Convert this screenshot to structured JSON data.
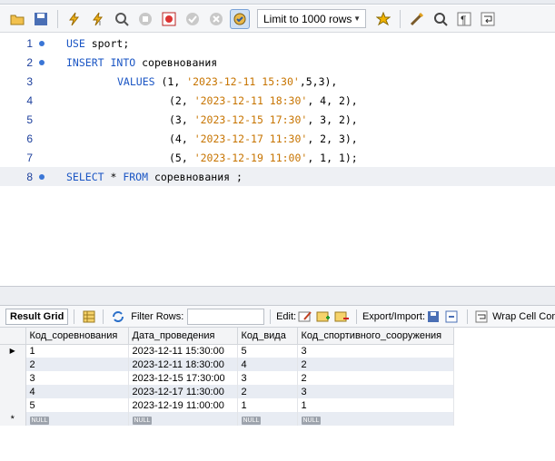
{
  "toolbar": {
    "limit_select": "Limit to 1000 rows"
  },
  "editor": {
    "lines": [
      {
        "n": "1",
        "dot": true
      },
      {
        "n": "2",
        "dot": true
      },
      {
        "n": "3",
        "dot": false
      },
      {
        "n": "4",
        "dot": false
      },
      {
        "n": "5",
        "dot": false
      },
      {
        "n": "6",
        "dot": false
      },
      {
        "n": "7",
        "dot": false
      },
      {
        "n": "8",
        "dot": true
      }
    ],
    "tokens": {
      "use": "USE",
      "use_rest": " sport;",
      "insert": "INSERT",
      "into": "INTO",
      "table": " соревнования",
      "values": "VALUES",
      "r1": [
        "(1, ",
        "'2023-12-11 15:30'",
        ",5,3),"
      ],
      "r2": [
        "(2, ",
        "'2023-12-11 18:30'",
        ", 4, 2),"
      ],
      "r3": [
        "(3, ",
        "'2023-12-15 17:30'",
        ", 3, 2),"
      ],
      "r4": [
        "(4, ",
        "'2023-12-17 11:30'",
        ", 2, 3),"
      ],
      "r5": [
        "(5, ",
        "'2023-12-19 11:00'",
        ", 1, 1);"
      ],
      "select": "SELECT",
      "star": " * ",
      "from": "FROM",
      "select_rest": " соревнования ;"
    }
  },
  "results_toolbar": {
    "result_grid": "Result Grid",
    "filter_rows": "Filter Rows:",
    "edit": "Edit:",
    "export_import": "Export/Import:",
    "wrap_cell": "Wrap Cell Cor"
  },
  "grid": {
    "columns": [
      "Код_соревнования",
      "Дата_проведения",
      "Код_вида",
      "Код_спортивного_сооружения"
    ],
    "rows": [
      [
        "1",
        "2023-12-11 15:30:00",
        "5",
        "3"
      ],
      [
        "2",
        "2023-12-11 18:30:00",
        "4",
        "2"
      ],
      [
        "3",
        "2023-12-15 17:30:00",
        "3",
        "2"
      ],
      [
        "4",
        "2023-12-17 11:30:00",
        "2",
        "3"
      ],
      [
        "5",
        "2023-12-19 11:00:00",
        "1",
        "1"
      ]
    ],
    "null_label": "NULL",
    "current_marker": "▶",
    "new_marker": "*"
  }
}
